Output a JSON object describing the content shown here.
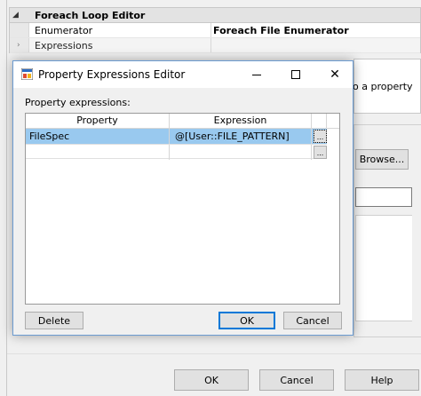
{
  "background": {
    "property_grid": {
      "header": "Foreach Loop Editor",
      "rows": [
        {
          "name": "Enumerator",
          "value": "Foreach File Enumerator"
        },
        {
          "name": "Expressions",
          "value": ""
        }
      ]
    },
    "panel_text": "o a property",
    "browse_label": "Browse...",
    "buttons": {
      "ok": "OK",
      "cancel": "Cancel",
      "help": "Help"
    }
  },
  "dialog": {
    "title": "Property Expressions Editor",
    "label": "Property expressions:",
    "grid": {
      "columns": [
        "Property",
        "Expression"
      ],
      "rows": [
        {
          "property": "FileSpec",
          "expression": "@[User::FILE_PATTERN]"
        }
      ],
      "ellipsis": "..."
    },
    "buttons": {
      "delete": "Delete",
      "ok": "OK",
      "cancel": "Cancel"
    }
  },
  "colors": {
    "selection": "#99c9ef",
    "accent": "#0078d7"
  }
}
